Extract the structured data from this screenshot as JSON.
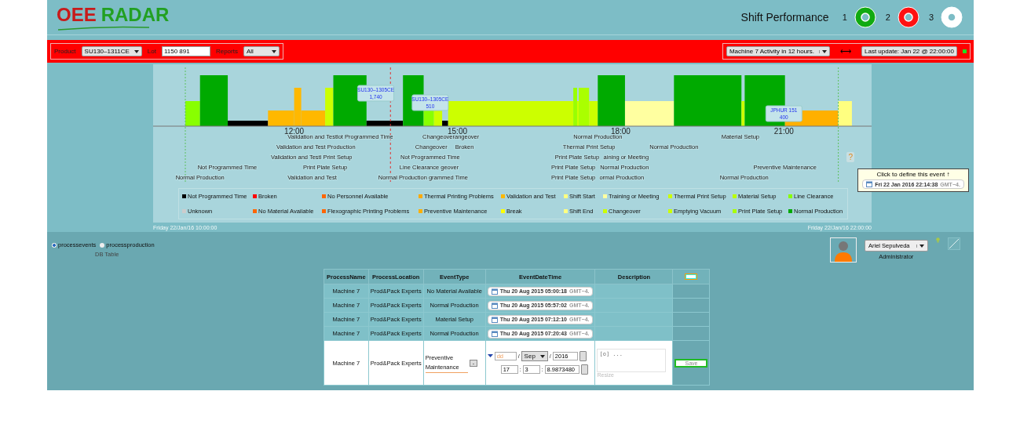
{
  "logo": {
    "first": "OEE",
    "second": "RADAR"
  },
  "shift_performance": {
    "title": "Shift Performance",
    "shifts": [
      {
        "label": "1",
        "color": "#11aa11"
      },
      {
        "label": "2",
        "color": "#ff1111"
      },
      {
        "label": "3",
        "color": "#ffffff"
      }
    ]
  },
  "filter_bar": {
    "product": {
      "label": "Product",
      "value": "SU130–1311CE"
    },
    "lot": {
      "label": "Lot",
      "value": "1150 891"
    },
    "reports": {
      "label": "Reports",
      "value": "All"
    },
    "activity": {
      "value": "Machine 7 Activity in 12 hours."
    },
    "swap": "⟷",
    "last_update": "Last update: Jan 22 @ 22:00:00",
    "live": true
  },
  "timeline": {
    "axis_labels": [
      "12:00",
      "15:00",
      "18:00",
      "21:00"
    ],
    "callouts": [
      {
        "lot": "SU130–1305CE",
        "count": "1,740"
      },
      {
        "lot": "SU130–1305CE",
        "count": "510"
      },
      {
        "lot": "JPHUR 151",
        "count": "400"
      }
    ],
    "event_rows": [
      [
        "Validation and Testlot Programmed Time",
        "Changeoverangeover",
        "Normal Production",
        "Material Setup"
      ],
      [
        "Validation and Test Production",
        "Changeover",
        "Broken",
        "Thermal Print Setup",
        "Normal Production"
      ],
      [
        "Validation and Testl Print Setup",
        "Not Programmed Time",
        "Print Plate Setup",
        "aining or Meeting"
      ],
      [
        "Not Programmed Time",
        "Print Plate Setup",
        "Line Clearance geover",
        "Print Plate Setup",
        "Normal Production",
        "Preventive Maintenance"
      ],
      [
        "Normal Production",
        "Validation and Test",
        "Normal Production grammed Time",
        "Print Plate Setup",
        "ormal Production",
        "Normal Production"
      ]
    ],
    "legend": [
      {
        "label": "Not Programmed Time",
        "color": "#000000"
      },
      {
        "label": "Broken",
        "color": "#ff0000"
      },
      {
        "label": "No Personnel Available",
        "color": "#ff6600"
      },
      {
        "label": "Thermal Printing Problems",
        "color": "#ffaa00"
      },
      {
        "label": "Validation and Test",
        "color": "#ffb800"
      },
      {
        "label": "Shift Start",
        "color": "#ffff80"
      },
      {
        "label": "Training or Meeting",
        "color": "#ffffa0"
      },
      {
        "label": "Thermal Print Setup",
        "color": "#ccff00"
      },
      {
        "label": "Material Setup",
        "color": "#bbff00"
      },
      {
        "label": "Line Clearance",
        "color": "#88ff00"
      },
      {
        "label": "Unknown",
        "color": "#cccccc"
      },
      {
        "label": "No Material Available",
        "color": "#ff6601"
      },
      {
        "label": "Flexographic Printing Problems",
        "color": "#ff6602"
      },
      {
        "label": "Preventive Maintenance",
        "color": "#ffb000"
      },
      {
        "label": "Break",
        "color": "#ffff00"
      },
      {
        "label": "Shift End",
        "color": "#ffff81"
      },
      {
        "label": "Changeover",
        "color": "#ccff01"
      },
      {
        "label": "Emptying Vacuum",
        "color": "#ccff02"
      },
      {
        "label": "Print Plate Setup",
        "color": "#aaff00"
      },
      {
        "label": "Normal Production",
        "color": "#00aa00"
      }
    ],
    "undefined_event": {
      "mark": "?",
      "tooltip": "Click to define this event ↑",
      "date": "Fri 22 Jan 2016 22:14:38",
      "zone": "GMT−4."
    },
    "start_label": "Friday 22/Jan/16 10:00:00",
    "end_label": "Friday 22/Jan/16 22:00:00"
  },
  "db_table": {
    "options": [
      {
        "label": "processevents",
        "selected": true
      },
      {
        "label": "processproduction",
        "selected": false
      }
    ],
    "caption": "DB Table"
  },
  "user": {
    "name": "Ariel Sepulveda",
    "role": "Administrator"
  },
  "table": {
    "columns": [
      "ProcessName",
      "ProcessLocation",
      "EventType",
      "EventDateTime",
      "Description"
    ],
    "rows": [
      {
        "process": "Machine 7",
        "location": "Prod&Pack Experts",
        "event": "No Material Available",
        "date": "Thu 20 Aug 2015 05:00:18",
        "zone": "GMT−4."
      },
      {
        "process": "Machine 7",
        "location": "Prod&Pack Experts",
        "event": "Normal Production",
        "date": "Thu 20 Aug 2015 05:57:02",
        "zone": "GMT−4."
      },
      {
        "process": "Machine 7",
        "location": "Prod&Pack Experts",
        "event": "Material Setup",
        "date": "Thu 20 Aug 2015 07:12:10",
        "zone": "GMT−4."
      },
      {
        "process": "Machine 7",
        "location": "Prod&Pack Experts",
        "event": "Normal Production",
        "date": "Thu 20 Aug 2015 07:20:43",
        "zone": "GMT−4."
      }
    ],
    "edit_row": {
      "process": "Machine 7",
      "location": "Prod&Pack Experts",
      "event": "Preventive Maintenance",
      "minus": "-",
      "day_placeholder": "dd",
      "month_separator": "/",
      "month": "Sep",
      "year_separator": "/",
      "year": "2016",
      "hour": "17",
      "minute_separator": ":",
      "minute": "3",
      "second_separator": ":",
      "second": "8.9873480",
      "description_placeholder": "[o] ...",
      "resize": "Resize",
      "save": "Save"
    }
  }
}
